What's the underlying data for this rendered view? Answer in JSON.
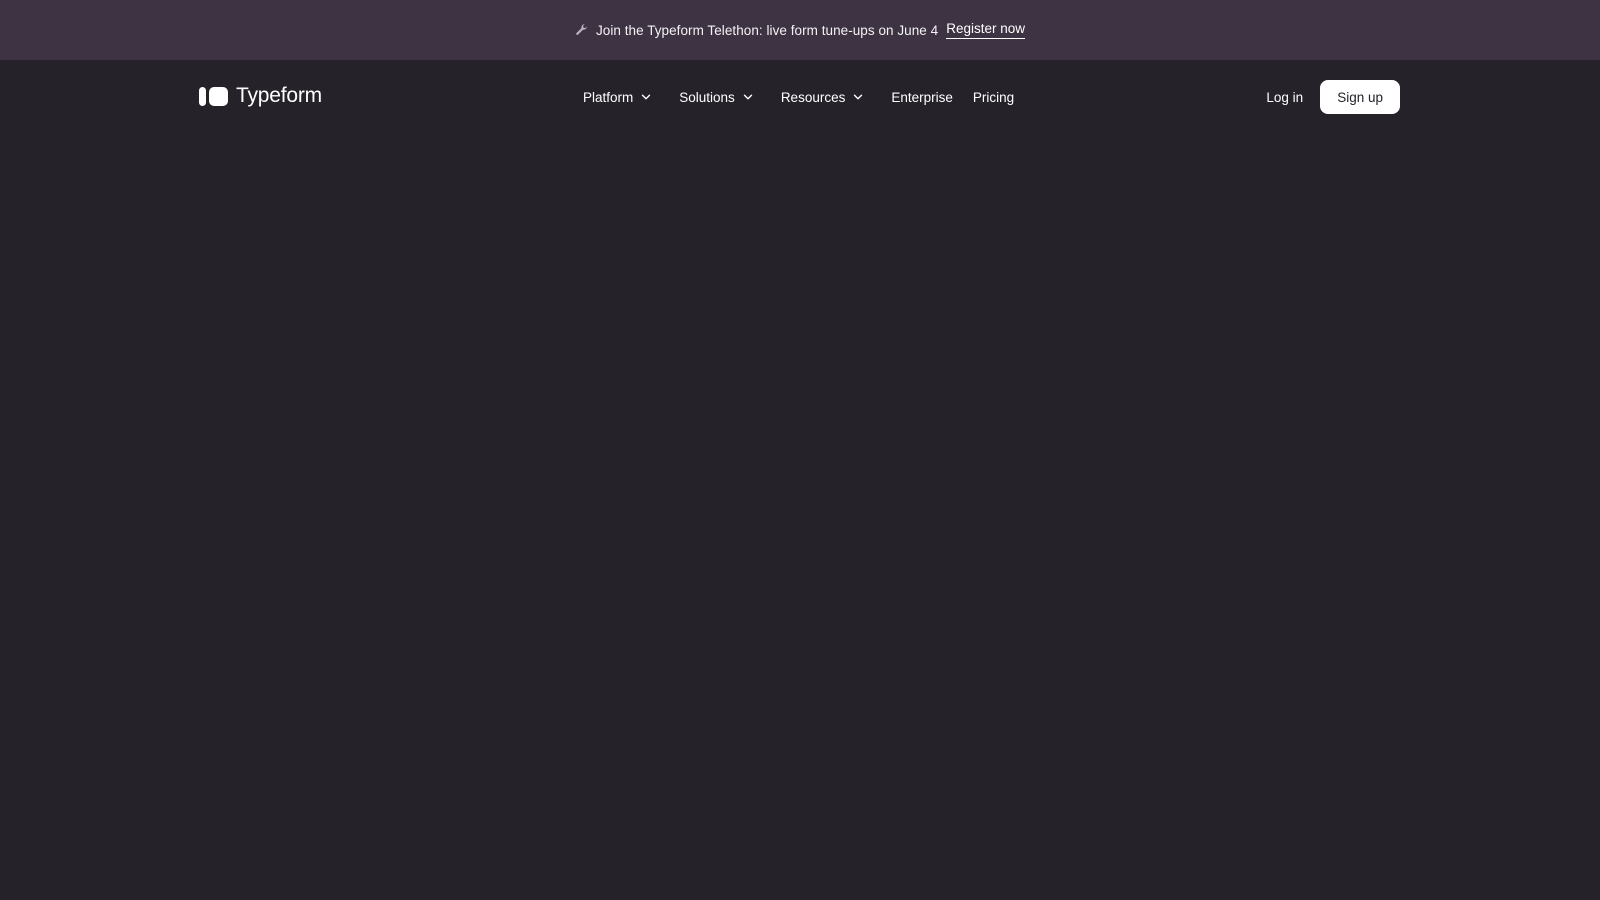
{
  "colors": {
    "banner_bg": "#3d3343",
    "page_bg": "#26222a",
    "text": "#ffffff",
    "signup_bg": "#ffffff"
  },
  "banner": {
    "icon": "wrench-icon",
    "text": "Join the Typeform Telethon: live form tune-ups on June 4",
    "link_label": "Register now"
  },
  "header": {
    "logo_text": "Typeform",
    "nav": [
      {
        "label": "Platform",
        "dropdown": true
      },
      {
        "label": "Solutions",
        "dropdown": true
      },
      {
        "label": "Resources",
        "dropdown": true
      },
      {
        "label": "Enterprise",
        "dropdown": false
      },
      {
        "label": "Pricing",
        "dropdown": false
      }
    ],
    "login_label": "Log in",
    "signup_label": "Sign up"
  }
}
